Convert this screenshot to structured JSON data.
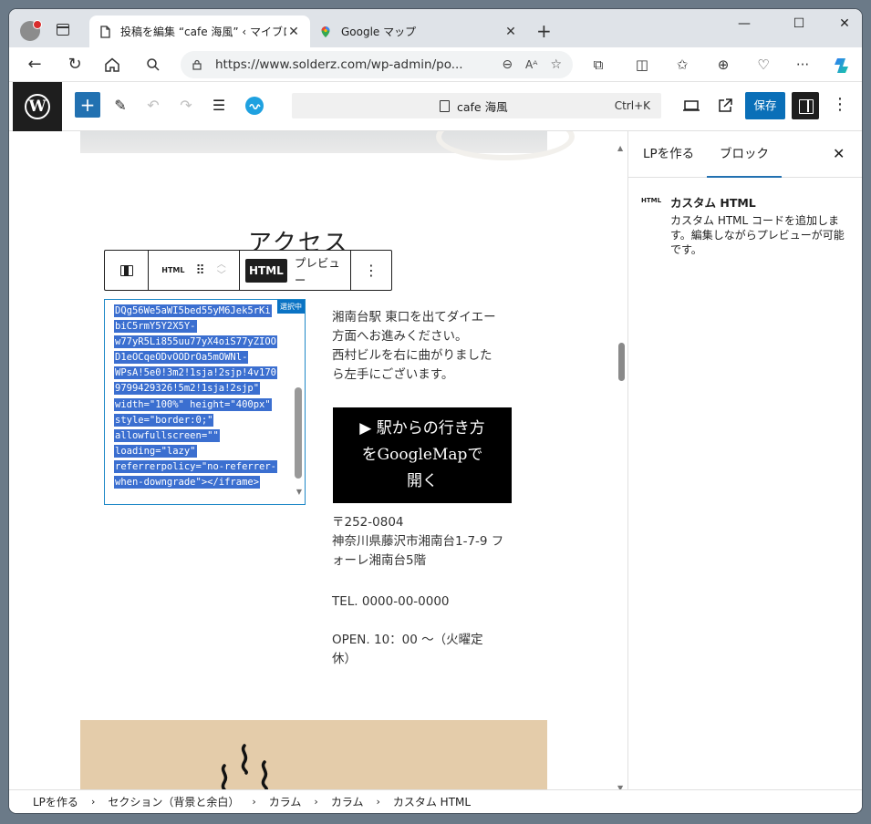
{
  "browser": {
    "tabs": [
      {
        "title": "投稿を編集 “cafe 海風” ‹ マイブログ",
        "close": "✕"
      },
      {
        "title": "Google マップ",
        "close": "✕"
      }
    ],
    "new_tab": "+",
    "window_controls": [
      "—",
      "☐",
      "✕"
    ],
    "url": "https://www.solderz.com/wp-admin/po..."
  },
  "wp_toolbar": {
    "add": "+",
    "doc_title": "cafe 海風",
    "shortcut": "Ctrl+K",
    "save": "保存"
  },
  "block_toolbar": {
    "html_tiny": "HTML",
    "html_tab": "HTML",
    "preview_tab": "プレビュー",
    "more": "⋮"
  },
  "code_editor": {
    "badge": "選択中",
    "lines": [
      "DQg56We5aWI5bed55yM6Jek5rKi",
      "biC5rmY5Y2X5Y-",
      "w77yR5Li855uu77yX4oiS77yZIOO",
      "D1eOCqeODvOODrOa5mOWNl-",
      "WPsA!5e0!3m2!1sja!2sjp!4v170",
      "9799429326!5m2!1sja!2sjp\"",
      "width=\"100%\" height=\"400px\"",
      "style=\"border:0;\"",
      "allowfullscreen=\"\"",
      "loading=\"lazy\"",
      "referrerpolicy=\"no-referrer-",
      "when-downgrade\"></iframe>"
    ]
  },
  "content": {
    "heading_partial": "アクセス",
    "directions": [
      "湘南台駅 東口を出てダイエー",
      "方面へお進みください。",
      "西村ビルを右に曲がりました",
      "ら左手にございます。"
    ],
    "map_button": [
      "▶ 駅からの行き方",
      "をGoogleMapで",
      "開く"
    ],
    "address": [
      "〒252-0804",
      "神奈川県藤沢市湘南台1-7-9 フ",
      "ォーレ湘南台5階"
    ],
    "tel": "TEL. 0000-00-0000",
    "open": [
      "OPEN. 10：00 〜（火曜定",
      "休）"
    ]
  },
  "sidebar": {
    "tab_lp": "LPを作る",
    "tab_block": "ブロック",
    "close": "✕",
    "block_icon": "HTML",
    "block_name": "カスタム HTML",
    "block_desc": "カスタム HTML コードを追加します。編集しながらプレビューが可能です。"
  },
  "breadcrumb": [
    "LPを作る",
    "セクション（背景と余白）",
    "カラム",
    "カラム",
    "カスタム HTML"
  ],
  "colors": {
    "accent": "#2271b1",
    "selection": "#3b6fd0",
    "map_bg": "#000000",
    "photo_bg": "#e4ccaa"
  }
}
